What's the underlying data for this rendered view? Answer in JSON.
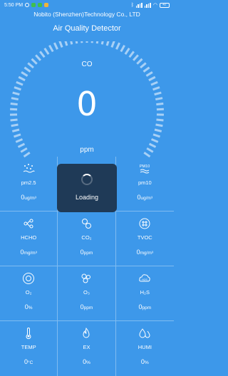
{
  "status_bar": {
    "time": "5:50 PM",
    "battery": "47"
  },
  "header": {
    "company": "Nobito (Shenzhen)Technology Co., LTD",
    "title": "Air Quality Detector"
  },
  "gauge": {
    "label": "CO",
    "value": "0",
    "unit": "ppm"
  },
  "sensors": [
    {
      "name": "pm2.5",
      "value": "0",
      "unit": "ug/m³",
      "icon": "particles-icon"
    },
    {
      "name": "",
      "value": "",
      "unit": "",
      "icon": "pm1-icon"
    },
    {
      "name": "pm10",
      "value": "0",
      "unit": "ug/m³",
      "icon": "pm10-icon"
    },
    {
      "name": "HCHO",
      "value": "0",
      "unit": "mg/m³",
      "icon": "hcho-icon"
    },
    {
      "name": "CO₂",
      "value": "0",
      "unit": "ppm",
      "icon": "co2-icon"
    },
    {
      "name": "TVOC",
      "value": "0",
      "unit": "mg/m³",
      "icon": "tvoc-icon"
    },
    {
      "name": "O₂",
      "value": "0",
      "unit": "%",
      "icon": "o2-icon"
    },
    {
      "name": "O₃",
      "value": "0",
      "unit": "ppm",
      "icon": "o3-icon"
    },
    {
      "name": "H₂S",
      "value": "0",
      "unit": "ppm",
      "icon": "h2s-icon"
    },
    {
      "name": "TEMP",
      "value": "0",
      "unit": "°C",
      "icon": "thermometer-icon"
    },
    {
      "name": "EX",
      "value": "0",
      "unit": "%",
      "icon": "flame-icon"
    },
    {
      "name": "HUMI",
      "value": "0",
      "unit": "%",
      "icon": "droplets-icon"
    }
  ],
  "loading": {
    "text": "Loading"
  }
}
